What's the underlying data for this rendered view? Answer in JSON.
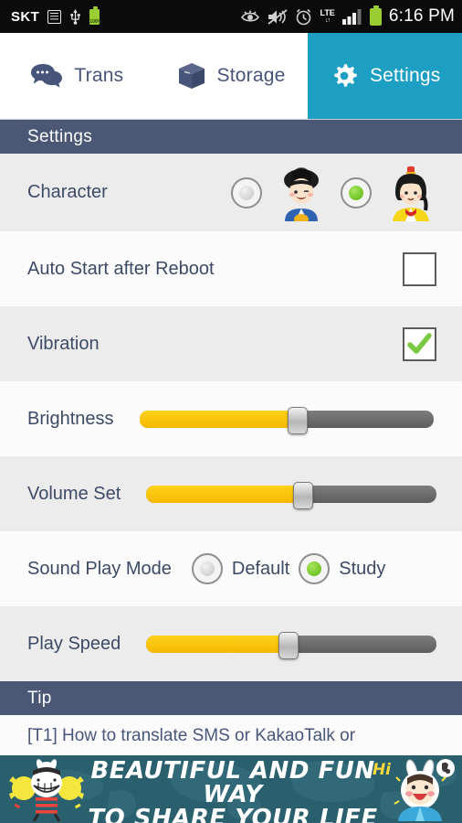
{
  "statusbar": {
    "carrier": "SKT",
    "icons_left": [
      "list-icon",
      "usb-icon",
      "battery-charging-icon"
    ],
    "battery_percent": "100%",
    "icons_right": [
      "smart-stay-eye-icon",
      "sound-mute-icon",
      "alarm-icon",
      "lte-icon",
      "signal-bars-icon",
      "battery-icon"
    ],
    "network": "LTE",
    "clock": "6:16 PM"
  },
  "tabs": [
    {
      "label": "Trans",
      "icon": "chat-bubbles-icon",
      "active": false
    },
    {
      "label": "Storage",
      "icon": "box-icon",
      "active": false
    },
    {
      "label": "Settings",
      "icon": "gear-icon",
      "active": true
    }
  ],
  "sections": {
    "settings_header": "Settings",
    "tip_header": "Tip"
  },
  "settings": {
    "character": {
      "label": "Character",
      "options": [
        {
          "name": "male-character",
          "selected": false
        },
        {
          "name": "female-character",
          "selected": true
        }
      ]
    },
    "auto_start": {
      "label": "Auto Start after Reboot",
      "checked": false
    },
    "vibration": {
      "label": "Vibration",
      "checked": true
    },
    "brightness": {
      "label": "Brightness",
      "value": 54
    },
    "volume_set": {
      "label": "Volume Set",
      "value": 57
    },
    "sound_play_mode": {
      "label": "Sound Play Mode",
      "options": [
        {
          "label": "Default",
          "selected": false
        },
        {
          "label": "Study",
          "selected": true
        }
      ]
    },
    "play_speed": {
      "label": "Play Speed",
      "value": 49
    }
  },
  "tip": {
    "items": [
      "[T1] How to translate SMS or KakaoTalk or"
    ]
  },
  "ad": {
    "line1": "BEAUTIFUL AND FUN WAY",
    "line2": "TO SHARE YOUR LIFE",
    "greeting": "Hi"
  },
  "colors": {
    "accent_tab": "#1d9fc4",
    "header_bar": "#4a5876",
    "slider_fill": "#f5b800",
    "selected_green": "#6cc022",
    "text": "#3d4a66",
    "ad_bg": "#2a5f6e"
  }
}
